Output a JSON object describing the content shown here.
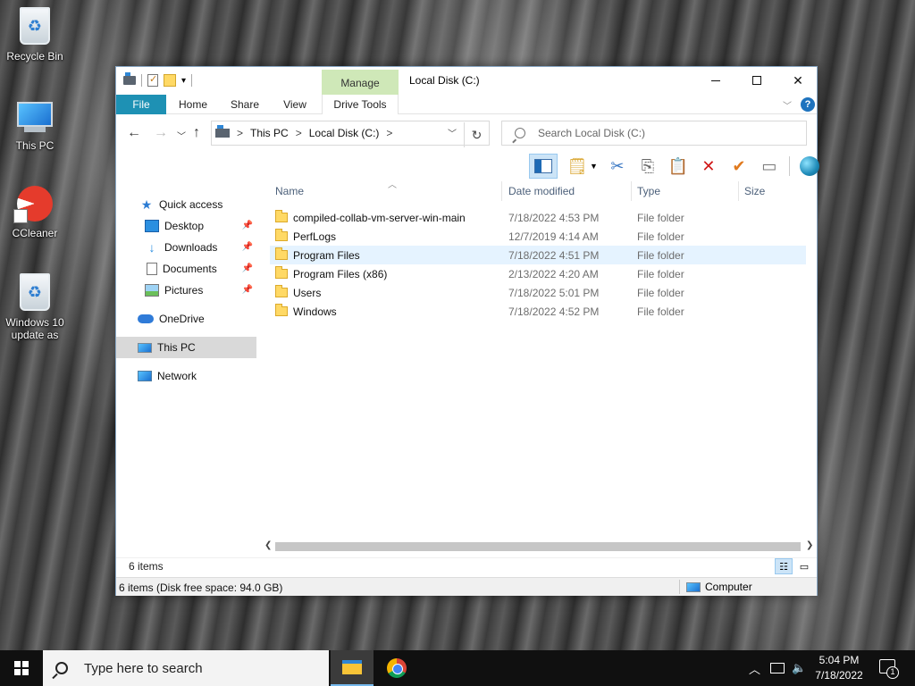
{
  "desktop": {
    "icons": [
      {
        "label": "Recycle Bin",
        "icon": "recycle-bin-icon"
      },
      {
        "label": "This PC",
        "icon": "computer-icon"
      },
      {
        "label": "CCleaner",
        "icon": "ccleaner-icon"
      },
      {
        "label": "Windows 10 update as",
        "icon": "recycle-bin-icon"
      }
    ]
  },
  "window": {
    "title": "Local Disk (C:)",
    "context_tab_group": "Manage",
    "ribbon_tabs": [
      "File",
      "Home",
      "Share",
      "View",
      "Drive Tools"
    ],
    "help_glyph": "?",
    "address": {
      "crumbs": [
        "This PC",
        "Local Disk (C:)"
      ],
      "separator": ">"
    },
    "search": {
      "placeholder": "Search Local Disk (C:)"
    },
    "nav": {
      "quick_access": "Quick access",
      "items": [
        {
          "label": "Desktop",
          "pinned": true
        },
        {
          "label": "Downloads",
          "pinned": true
        },
        {
          "label": "Documents",
          "pinned": true
        },
        {
          "label": "Pictures",
          "pinned": true
        }
      ],
      "onedrive": "OneDrive",
      "this_pc": "This PC",
      "network": "Network"
    },
    "columns": [
      "Name",
      "Date modified",
      "Type",
      "Size"
    ],
    "files": [
      {
        "name": "compiled-collab-vm-server-win-main",
        "date": "7/18/2022 4:53 PM",
        "type": "File folder"
      },
      {
        "name": "PerfLogs",
        "date": "12/7/2019 4:14 AM",
        "type": "File folder"
      },
      {
        "name": "Program Files",
        "date": "7/18/2022 4:51 PM",
        "type": "File folder"
      },
      {
        "name": "Program Files (x86)",
        "date": "2/13/2022 4:20 AM",
        "type": "File folder"
      },
      {
        "name": "Users",
        "date": "7/18/2022 5:01 PM",
        "type": "File folder"
      },
      {
        "name": "Windows",
        "date": "7/18/2022 4:52 PM",
        "type": "File folder"
      }
    ],
    "item_count": "6 items",
    "status_info": "6 items (Disk free space: 94.0 GB)",
    "status_location": "Computer"
  },
  "taskbar": {
    "search_placeholder": "Type here to search",
    "time": "5:04 PM",
    "date": "7/18/2022",
    "notification_count": "1"
  }
}
